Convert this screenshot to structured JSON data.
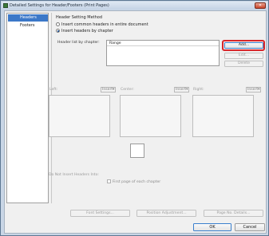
{
  "window": {
    "title": "Detailed Settings for Header/Footers (Print Pages)",
    "close_glyph": "✕"
  },
  "nav": {
    "items": [
      {
        "label": "Headers",
        "selected": true
      },
      {
        "label": "Footers",
        "selected": false
      }
    ]
  },
  "header_method": {
    "group_title": "Header Setting Method",
    "options": [
      {
        "label": "Insert common headers in entire document",
        "selected": false
      },
      {
        "label": "Insert headers by chapter",
        "selected": true
      }
    ],
    "list_label": "Header list by chapter:",
    "list_column": "Range",
    "buttons": {
      "add": "Add...",
      "edit": "Edit...",
      "delete": "Delete"
    }
  },
  "positions": {
    "left": "Left:",
    "center": "Center:",
    "right": "Right:",
    "insert": "Insert▾"
  },
  "do_not_insert": {
    "label": "Do Not Insert Headers Into:",
    "option": "First page of each chapter"
  },
  "bottom_buttons": {
    "font_settings": "Font Settings...",
    "position_adjustment": "Position Adjustment...",
    "page_no_details": "Page No. Details..."
  },
  "dialog_buttons": {
    "ok": "OK",
    "cancel": "Cancel"
  },
  "colors": {
    "selection": "#3b78c8",
    "highlight": "#d7262a"
  }
}
